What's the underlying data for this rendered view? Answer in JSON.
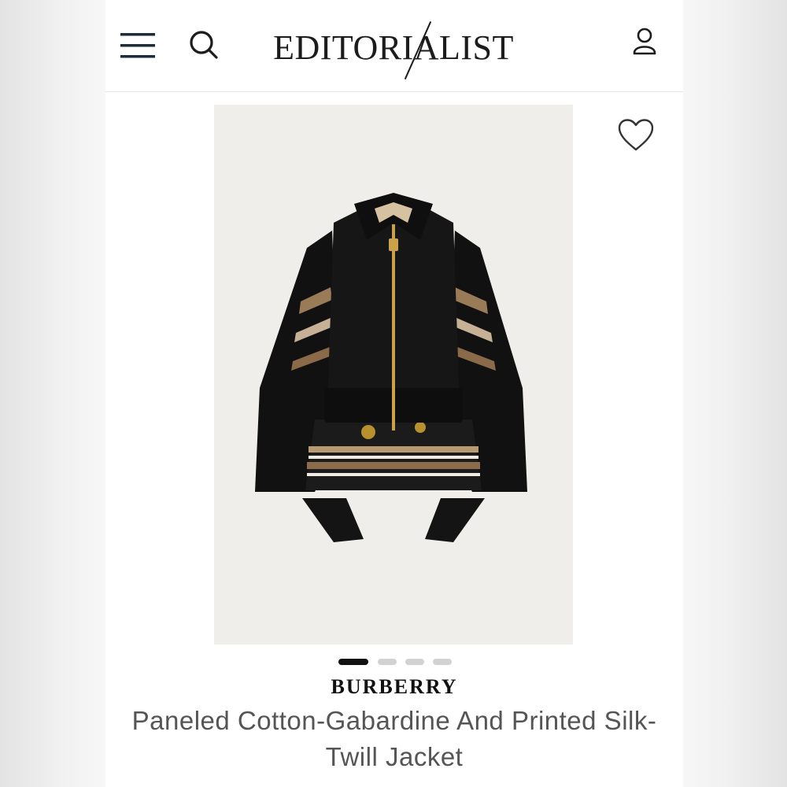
{
  "header": {
    "logo_text": "EDITORIALIST",
    "menu_icon": "hamburger-menu-icon",
    "search_icon": "search-icon",
    "account_icon": "user-account-icon"
  },
  "product": {
    "image_subject": "black cotton-gabardine zip jacket with printed silk-twill panels",
    "wishlist_icon": "heart-outline-icon",
    "carousel": {
      "total": 4,
      "active": 1
    },
    "brand": "BURBERRY",
    "title": "Paneled Cotton-Gabardine And Printed Silk-Twill Jacket"
  },
  "colors": {
    "accent": "#1c1c1c",
    "image_background": "#efeeeb",
    "text_muted": "#555555"
  }
}
